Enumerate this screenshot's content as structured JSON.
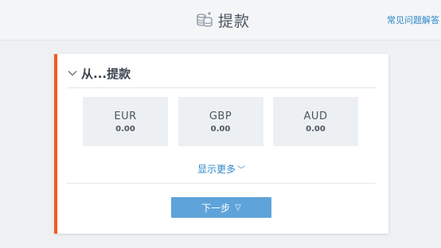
{
  "header": {
    "title": "提款",
    "faq_link": "常见问题解答"
  },
  "card": {
    "title": "从...提款",
    "currencies": [
      {
        "code": "EUR",
        "amount": "0.00"
      },
      {
        "code": "GBP",
        "amount": "0.00"
      },
      {
        "code": "AUD",
        "amount": "0.00"
      }
    ],
    "show_more": "显示更多",
    "next_button": "下一步",
    "next_arrow": "▽"
  },
  "colors": {
    "accent": "#f15a24",
    "link": "#2d88c7",
    "button": "#5ea3d9"
  }
}
